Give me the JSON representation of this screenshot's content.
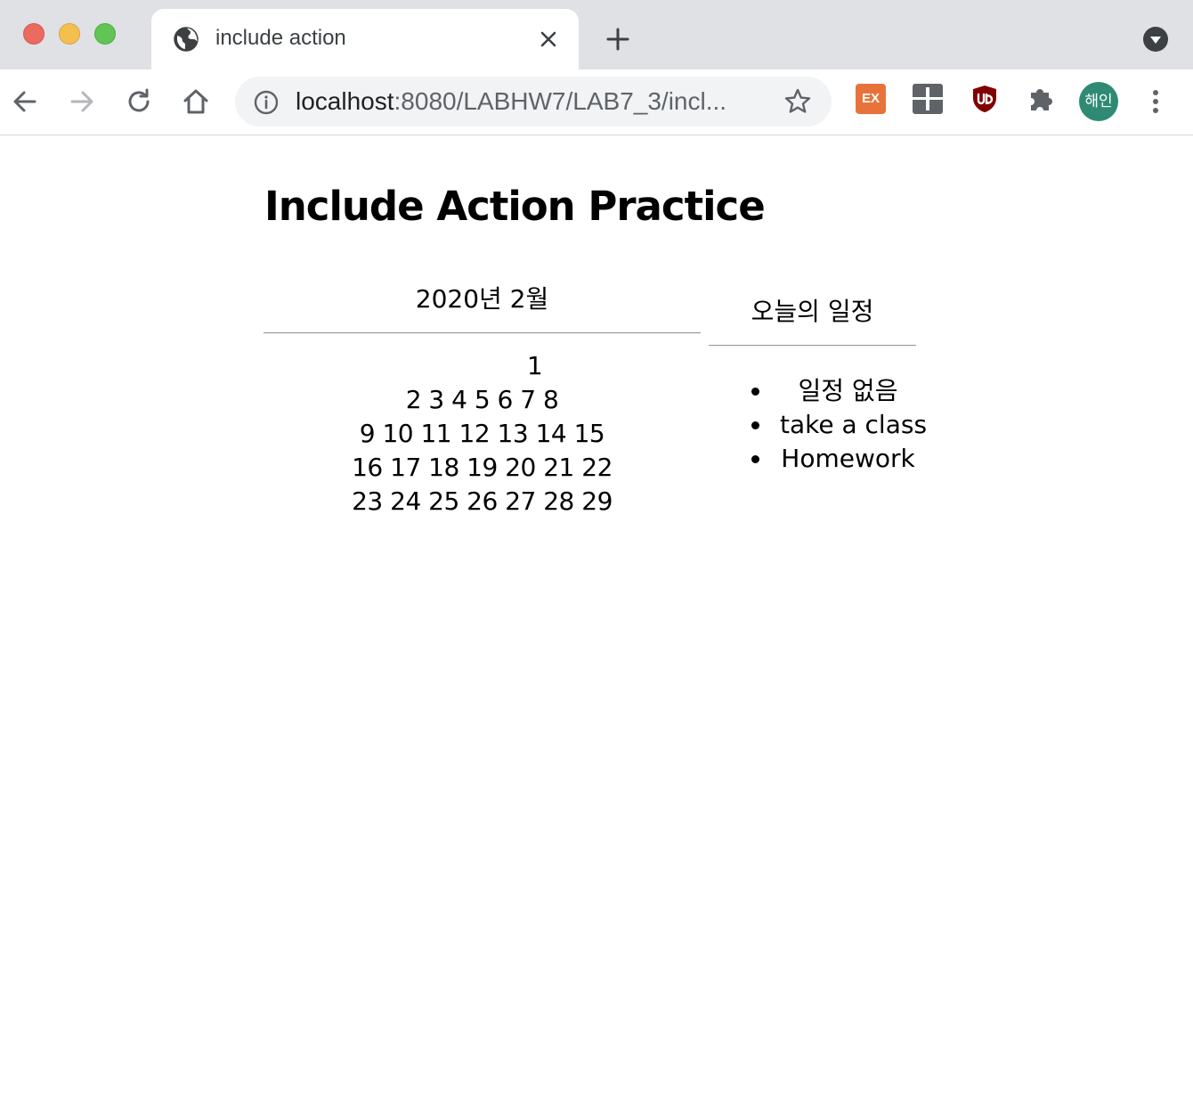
{
  "browser": {
    "tab_title": "include action",
    "url_host": "localhost",
    "url_rest": ":8080/LABHW7/LAB7_3/incl...",
    "profile_initials": "해인",
    "extensions": [
      {
        "name": "ex-extension-icon",
        "label": "EX"
      },
      {
        "name": "internet-archive-icon"
      },
      {
        "name": "ublock-origin-icon"
      },
      {
        "name": "puzzle-icon"
      }
    ],
    "colors": {
      "tabbar": "#dfe1e5",
      "avatar": "#2f8a74",
      "ex_extension": "#e8733a",
      "ublock": "#800000"
    }
  },
  "page": {
    "title": "Include Action Practice",
    "calendar": {
      "month": "2020년 2월",
      "weeks": [
        "1",
        "2 3 4 5 6 7 8",
        "9 10 11 12 13 14 15",
        "16 17 18 19 20 21 22",
        "23 24 25 26 27 28 29"
      ]
    },
    "schedule": {
      "title": "오늘의 일정",
      "items": [
        "일정 없음",
        "take a class",
        "Homework"
      ]
    }
  }
}
